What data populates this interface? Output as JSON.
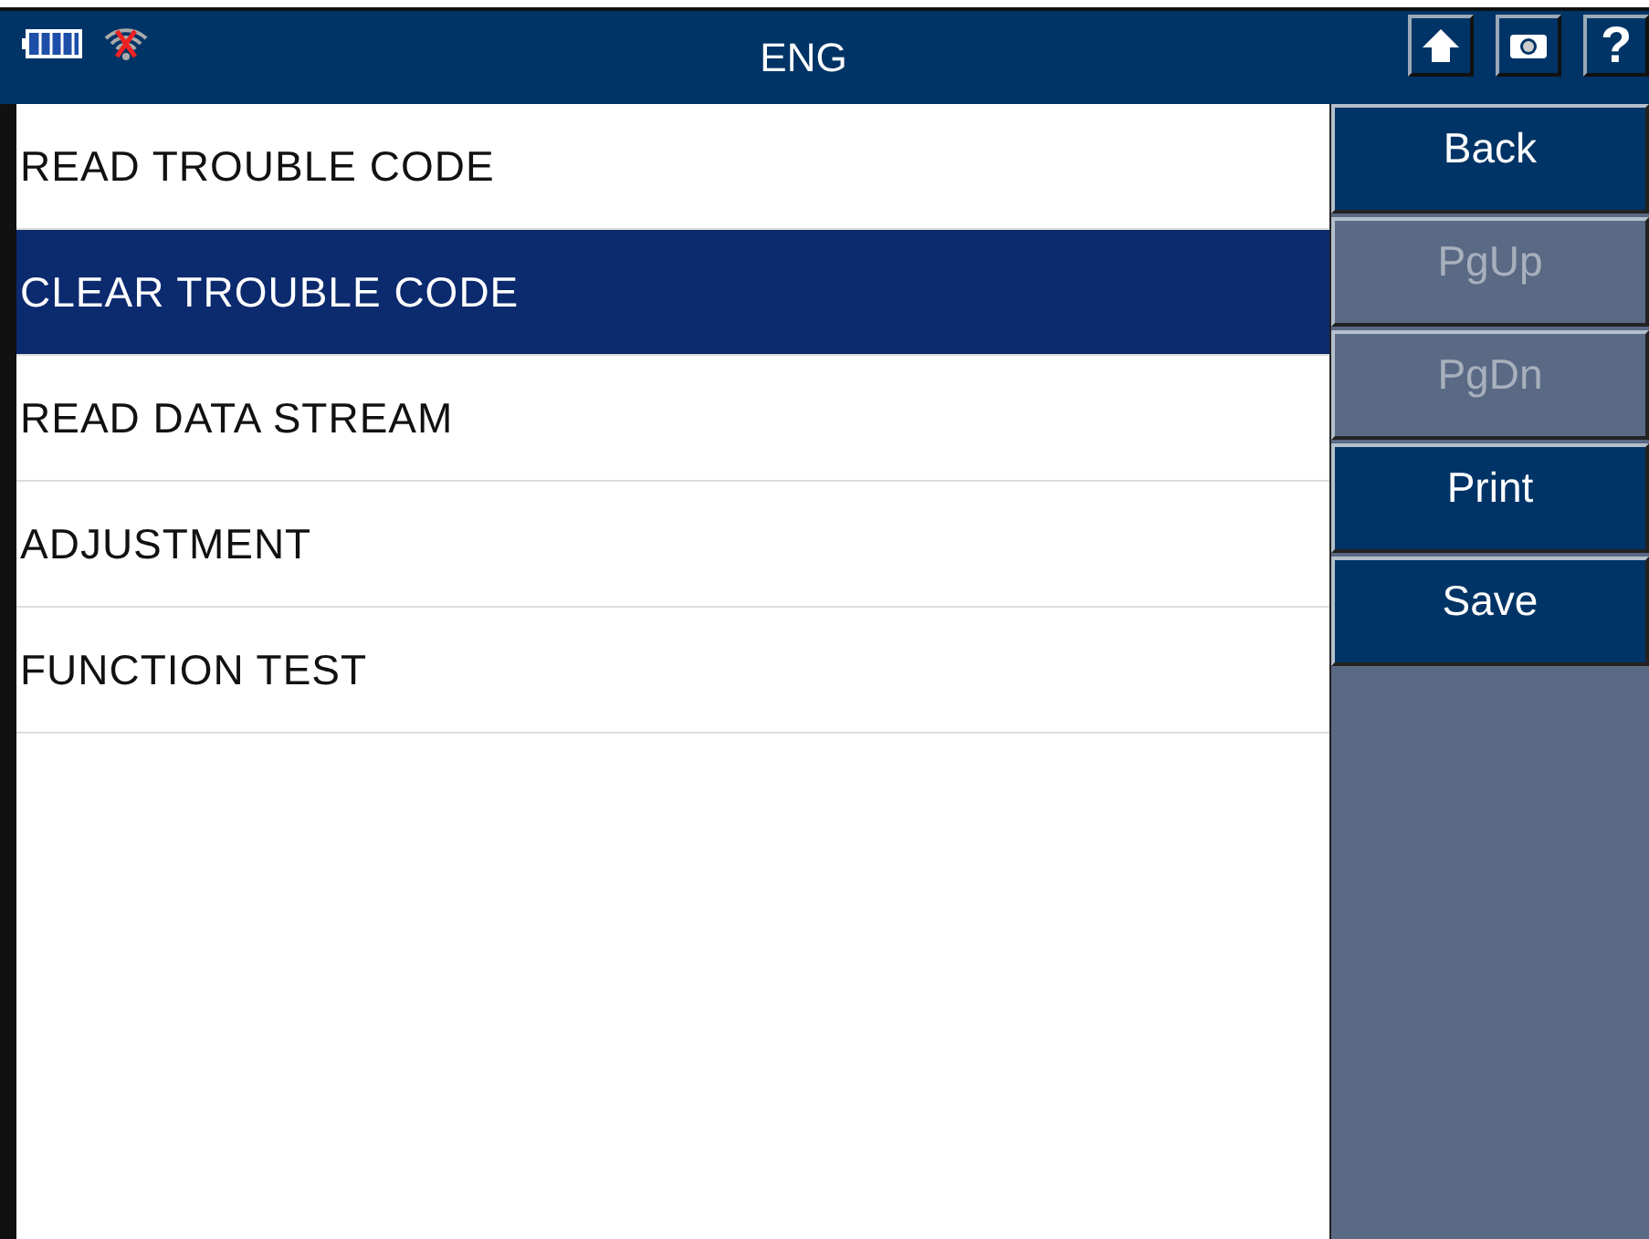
{
  "status_bar": {
    "title": "ENG",
    "help": "?"
  },
  "menu": [
    {
      "label": "READ TROUBLE CODE",
      "selected": false
    },
    {
      "label": "CLEAR TROUBLE CODE",
      "selected": true
    },
    {
      "label": "READ DATA STREAM",
      "selected": false
    },
    {
      "label": "ADJUSTMENT",
      "selected": false
    },
    {
      "label": "FUNCTION TEST",
      "selected": false
    }
  ],
  "buttons": [
    {
      "label": "Back",
      "disabled": false
    },
    {
      "label": "PgUp",
      "disabled": true
    },
    {
      "label": "PgDn",
      "disabled": true
    },
    {
      "label": "Print",
      "disabled": false
    },
    {
      "label": "Save",
      "disabled": false
    }
  ]
}
